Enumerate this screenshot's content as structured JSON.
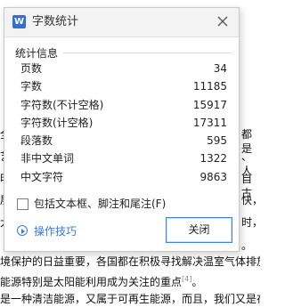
{
  "dialog": {
    "title": "字数统计",
    "app_logo_letter": "W",
    "section_title": "统计信息",
    "stats": [
      {
        "label": "页数",
        "value": "34"
      },
      {
        "label": "字数",
        "value": "11185"
      },
      {
        "label": "字符数(不计空格)",
        "value": "15917"
      },
      {
        "label": "字符数(计空格)",
        "value": "17311"
      },
      {
        "label": "段落数",
        "value": "595"
      },
      {
        "label": "非中文单词",
        "value": "1322"
      },
      {
        "label": "中文字符",
        "value": "9863"
      }
    ],
    "include_textbox_label": "包括文本框、脚注和尾注(F)",
    "tips_label": "操作技巧",
    "close_button_label": "关闭"
  },
  "document": {
    "left_fragments": [
      "全",
      "艺",
      "明",
      "展",
      "大",
      "汽"
    ],
    "right_fragments": [
      "都是",
      "、人",
      "自古",
      "快，",
      "时，",
      "。"
    ],
    "line1": "境保护的日益重要，各国都在积极寻找解决温室气体排放",
    "line2": "能源特别是太阳能利用成为关注的重点",
    "line2_footnote": "[4]",
    "line2_end": "。",
    "line3": "是一种清洁能源，又属于可再生能源，而且，我们又是在能"
  }
}
